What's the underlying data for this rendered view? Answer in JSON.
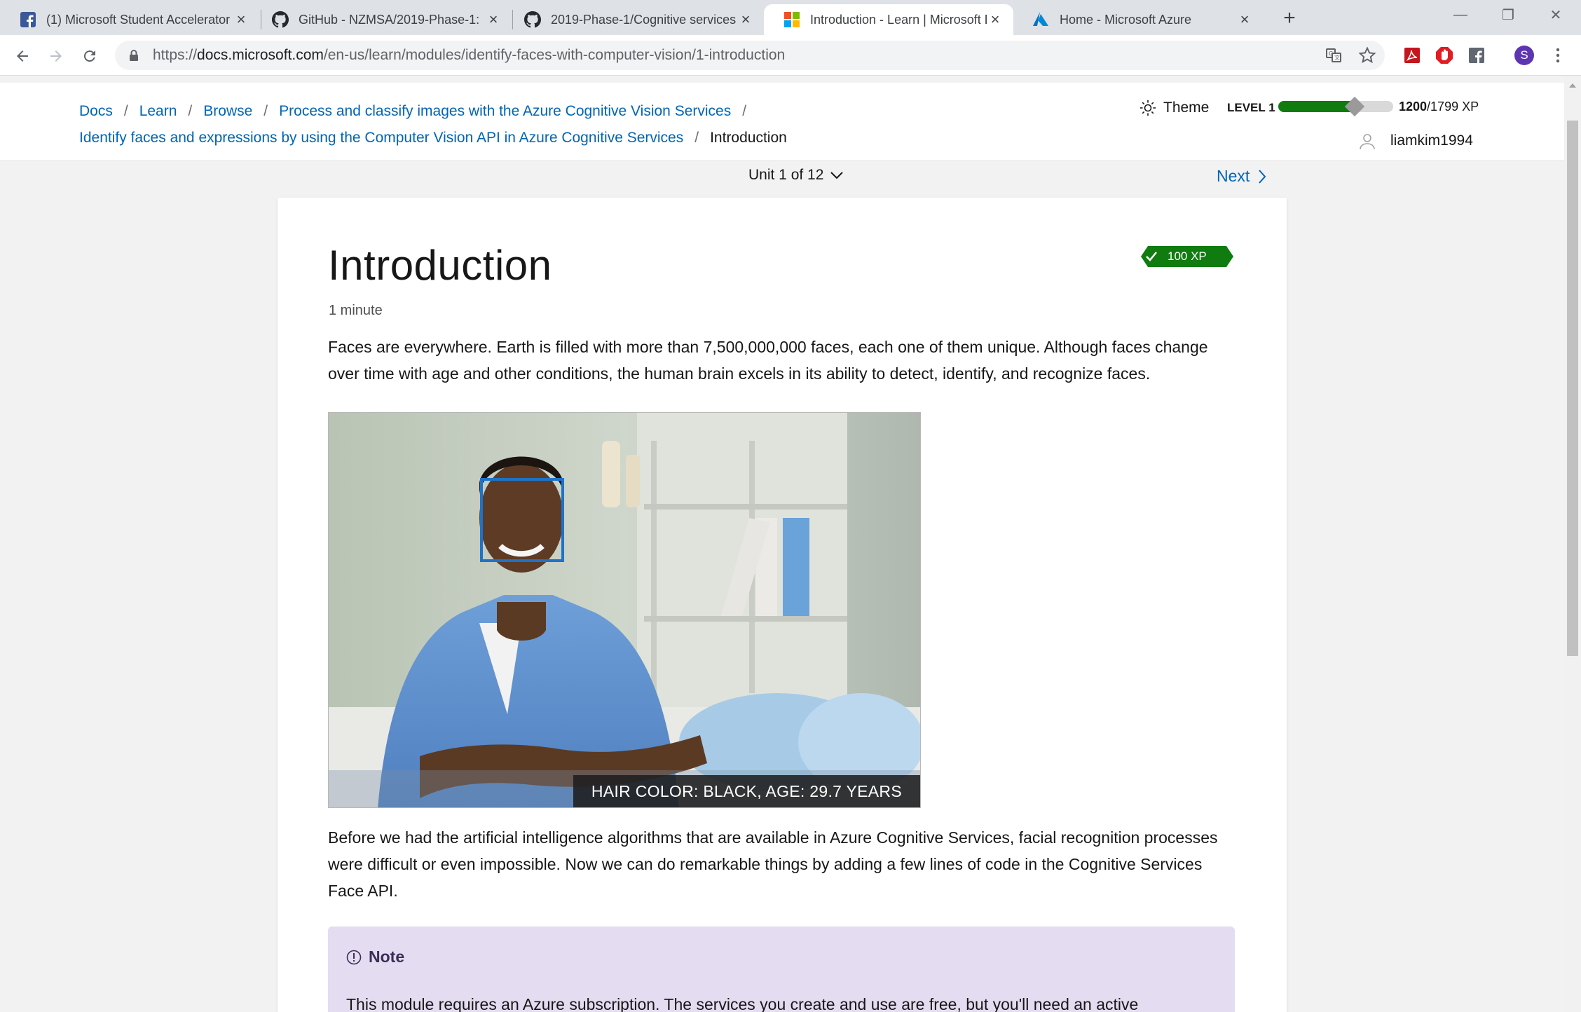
{
  "browser": {
    "tabs": [
      {
        "title": "(1) Microsoft Student Accelerator",
        "icon": "facebook-icon",
        "active": false
      },
      {
        "title": "GitHub - NZMSA/2019-Phase-1: ",
        "icon": "github-icon",
        "active": false
      },
      {
        "title": "2019-Phase-1/Cognitive services",
        "icon": "github-icon",
        "active": false
      },
      {
        "title": "Introduction - Learn | Microsoft Docs",
        "icon": "microsoft-icon",
        "active": true
      },
      {
        "title": "Home - Microsoft Azure",
        "icon": "azure-icon",
        "active": false
      }
    ],
    "url_prefix": "https://",
    "url_host": "docs.microsoft.com",
    "url_path": "/en-us/learn/modules/identify-faces-with-computer-vision/1-introduction",
    "profile_initial": "S"
  },
  "header": {
    "breadcrumbs": [
      "Docs",
      "Learn",
      "Browse",
      "Process and classify images with the Azure Cognitive Vision Services"
    ],
    "breadcrumbs2": [
      "Identify faces and expressions by using the Computer Vision API in Azure Cognitive Services"
    ],
    "current": "Introduction",
    "theme_label": "Theme",
    "level_label": "LEVEL 1",
    "xp_current": "1200",
    "xp_total": "/1799 XP",
    "xp_progress": 0.667,
    "username": "liamkim1994"
  },
  "unit": {
    "label": "Unit 1 of 12",
    "next_label": "Next"
  },
  "content": {
    "title": "Introduction",
    "duration": "1 minute",
    "xp_badge": "100 XP",
    "para1": "Faces are everywhere. Earth is filled with more than 7,500,000,000 faces, each one of them unique. Although faces change over time with age and other conditions, the human brain excels in its ability to detect, identify, and recognize faces.",
    "image_caption": "HAIR COLOR: BLACK, AGE: 29.7 YEARS",
    "para2": "Before we had the artificial intelligence algorithms that are available in Azure Cognitive Services, facial recognition processes were difficult or even impossible. Now we can do remarkable things by adding a few lines of code in the Cognitive Services Face API.",
    "note_title": "Note",
    "note_text": "This module requires an Azure subscription. The services you create and use are free, but you'll need an active"
  },
  "colors": {
    "link": "#0065b3",
    "xp_green": "#107c10",
    "note_bg": "#e4dcf0",
    "face_box": "#1e73c8"
  }
}
